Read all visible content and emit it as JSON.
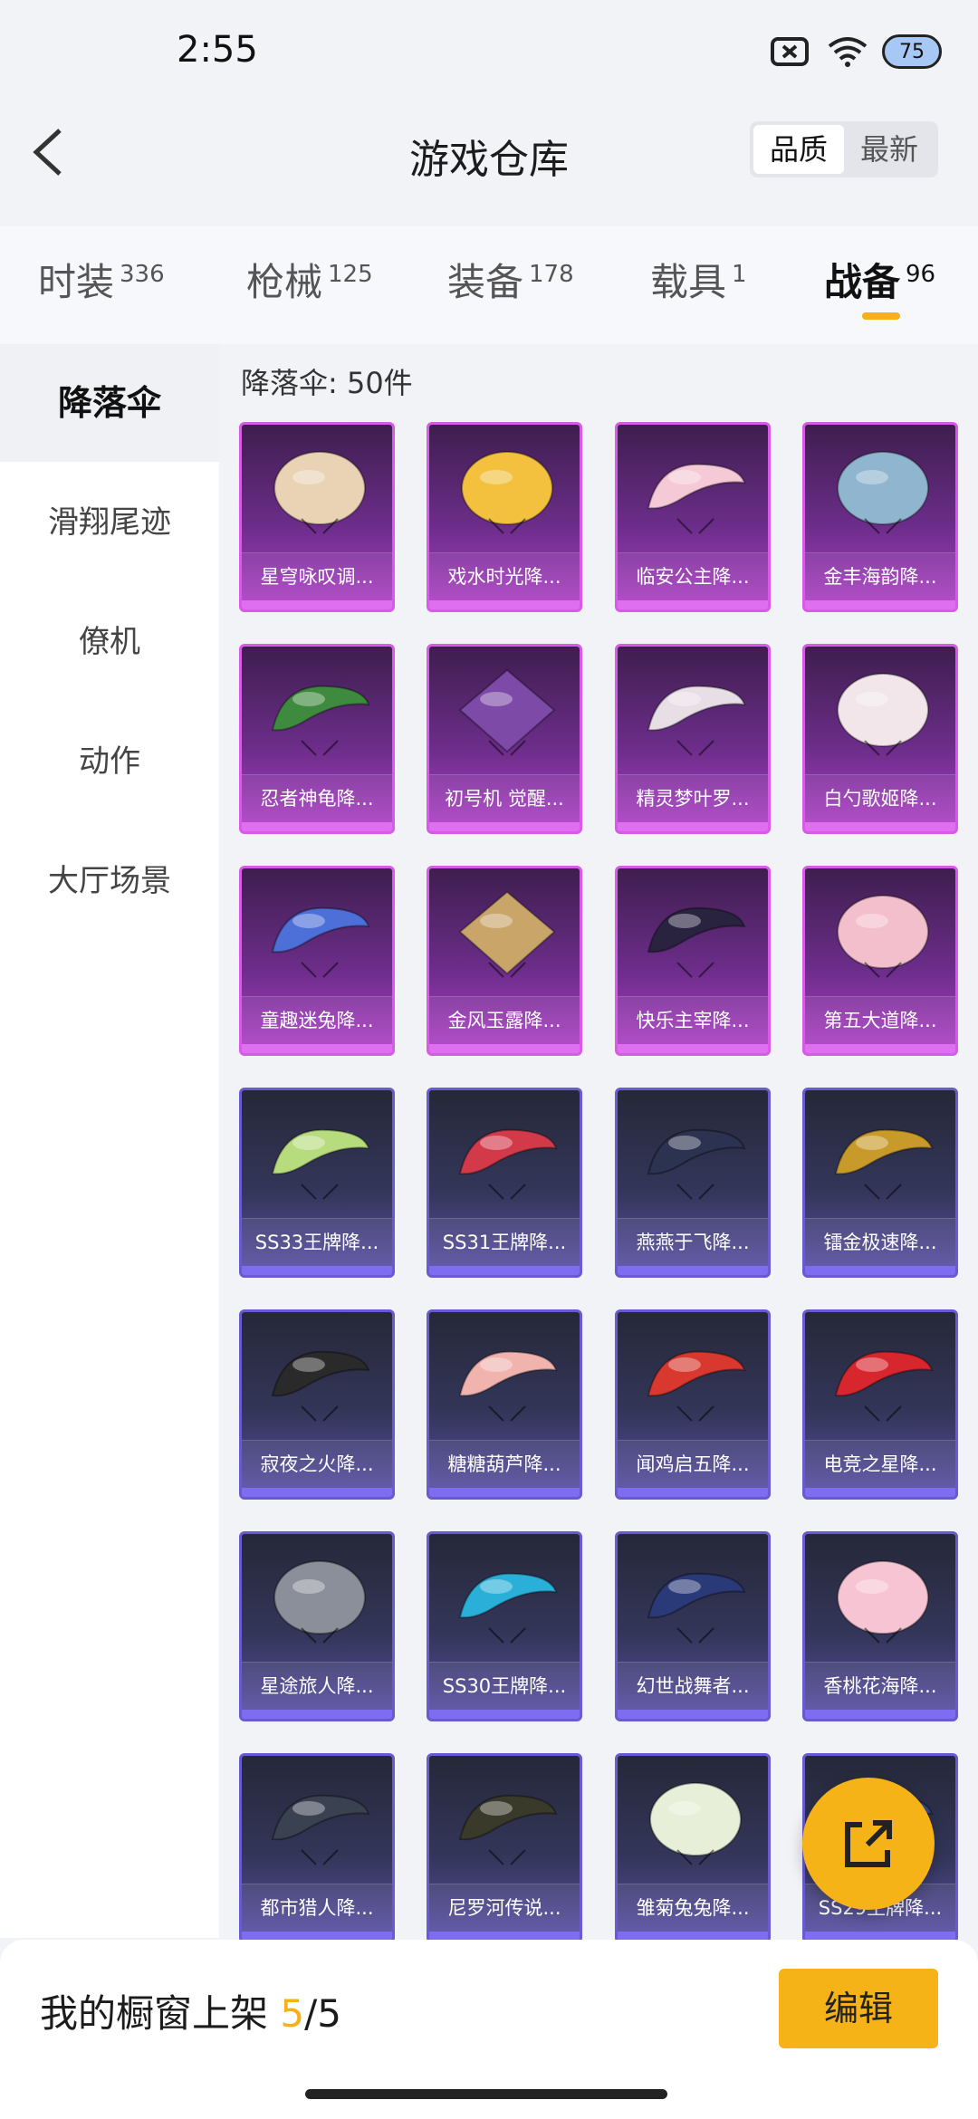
{
  "status": {
    "time": "2:55",
    "battery": "75"
  },
  "header": {
    "title": "游戏仓库",
    "sort_quality": "品质",
    "sort_newest": "最新"
  },
  "tabs": [
    {
      "label": "时装",
      "count": "336"
    },
    {
      "label": "枪械",
      "count": "125"
    },
    {
      "label": "装备",
      "count": "178"
    },
    {
      "label": "载具",
      "count": "1"
    },
    {
      "label": "战备",
      "count": "96"
    }
  ],
  "sidebar": {
    "items": [
      {
        "label": "降落伞"
      },
      {
        "label": "滑翔尾迹"
      },
      {
        "label": "僚机"
      },
      {
        "label": "动作"
      },
      {
        "label": "大厅场景"
      }
    ]
  },
  "content": {
    "heading": "降落伞: 50件",
    "items": [
      {
        "name": "星穹咏叹调...",
        "tier": "purple",
        "color": "#e9d3b4",
        "shape": "round"
      },
      {
        "name": "戏水时光降...",
        "tier": "purple",
        "color": "#f3c13e",
        "shape": "round"
      },
      {
        "name": "临安公主降...",
        "tier": "purple",
        "color": "#f5c9d6",
        "shape": "wing"
      },
      {
        "name": "金丰海韵降...",
        "tier": "purple",
        "color": "#8fb5cf",
        "shape": "round"
      },
      {
        "name": "忍者神龟降...",
        "tier": "purple",
        "color": "#3e8a3e",
        "shape": "wing"
      },
      {
        "name": "初号机 觉醒...",
        "tier": "purple",
        "color": "#7e4aa8",
        "shape": "diamond"
      },
      {
        "name": "精灵梦叶罗...",
        "tier": "purple",
        "color": "#e8dfe6",
        "shape": "wing"
      },
      {
        "name": "白勺歌姬降...",
        "tier": "purple",
        "color": "#f2e6ea",
        "shape": "round"
      },
      {
        "name": "童趣迷兔降...",
        "tier": "purple",
        "color": "#4c6fd8",
        "shape": "wing"
      },
      {
        "name": "金风玉露降...",
        "tier": "purple",
        "color": "#c9a56a",
        "shape": "diamond"
      },
      {
        "name": "快乐主宰降...",
        "tier": "purple",
        "color": "#2a2340",
        "shape": "wing"
      },
      {
        "name": "第五大道降...",
        "tier": "purple",
        "color": "#f4bfcc",
        "shape": "round"
      },
      {
        "name": "SS33王牌降...",
        "tier": "blue",
        "color": "#b7dc7e",
        "shape": "wing"
      },
      {
        "name": "SS31王牌降...",
        "tier": "blue",
        "color": "#d23a4a",
        "shape": "wing"
      },
      {
        "name": "燕燕于飞降...",
        "tier": "blue",
        "color": "#2c3350",
        "shape": "wing"
      },
      {
        "name": "镭金极速降...",
        "tier": "blue",
        "color": "#c89a2a",
        "shape": "wing"
      },
      {
        "name": "寂夜之火降...",
        "tier": "blue",
        "color": "#2a2a2a",
        "shape": "wing"
      },
      {
        "name": "糖糖葫芦降...",
        "tier": "blue",
        "color": "#f0b3ae",
        "shape": "wing"
      },
      {
        "name": "闻鸡启五降...",
        "tier": "blue",
        "color": "#d8382e",
        "shape": "wing"
      },
      {
        "name": "电竞之星降...",
        "tier": "blue",
        "color": "#d8262e",
        "shape": "wing"
      },
      {
        "name": "星途旅人降...",
        "tier": "blue",
        "color": "#8a8f9a",
        "shape": "round"
      },
      {
        "name": "SS30王牌降...",
        "tier": "blue",
        "color": "#2ab0d8",
        "shape": "wing"
      },
      {
        "name": "幻世战舞者...",
        "tier": "blue",
        "color": "#2a3a78",
        "shape": "wing"
      },
      {
        "name": "香桃花海降...",
        "tier": "blue",
        "color": "#f6c4d2",
        "shape": "round"
      },
      {
        "name": "都市猎人降...",
        "tier": "blue",
        "color": "#3a4150",
        "shape": "wing"
      },
      {
        "name": "尼罗河传说...",
        "tier": "blue",
        "color": "#3a3a2a",
        "shape": "wing"
      },
      {
        "name": "雏菊兔兔降...",
        "tier": "blue",
        "color": "#e8efd8",
        "shape": "round"
      },
      {
        "name": "SS29王牌降...",
        "tier": "blue",
        "color": "#3a4a8a",
        "shape": "wing"
      }
    ]
  },
  "bottom": {
    "shelf_label": "我的橱窗上架 ",
    "shelf_current": "5",
    "shelf_total": "/5",
    "edit_label": "编辑"
  },
  "colors": {
    "accent": "#f6b317",
    "purple_tier": "#d85be8",
    "blue_tier": "#6a5ad0"
  }
}
